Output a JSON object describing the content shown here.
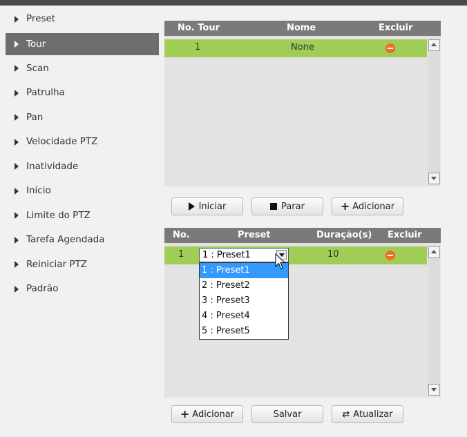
{
  "sidebar": {
    "items": [
      {
        "label": "Preset",
        "active": false
      },
      {
        "label": "Tour",
        "active": true
      },
      {
        "label": "Scan",
        "active": false
      },
      {
        "label": "Patrulha",
        "active": false
      },
      {
        "label": "Pan",
        "active": false
      },
      {
        "label": "Velocidade PTZ",
        "active": false
      },
      {
        "label": "Inatividade",
        "active": false
      },
      {
        "label": "Início",
        "active": false
      },
      {
        "label": "Limite do PTZ",
        "active": false
      },
      {
        "label": "Tarefa Agendada",
        "active": false
      },
      {
        "label": "Reiniciar PTZ",
        "active": false
      },
      {
        "label": "Padrão",
        "active": false
      }
    ]
  },
  "tour_table": {
    "headers": {
      "no": "No. Tour",
      "name": "Nome",
      "delete": "Excluir"
    },
    "rows": [
      {
        "no": "1",
        "name": "None",
        "delete_icon": "minus-circle-icon"
      }
    ]
  },
  "tour_buttons": {
    "start": "Iniciar",
    "stop": "Parar",
    "add": "Adicionar"
  },
  "preset_table": {
    "headers": {
      "no": "No.",
      "preset": "Preset",
      "duration": "Duração(s)",
      "delete": "Excluir"
    },
    "rows": [
      {
        "no": "1",
        "preset": "1 : Preset1",
        "duration": "10",
        "delete_icon": "minus-circle-icon"
      }
    ]
  },
  "preset_dropdown": {
    "selected": "1 : Preset1",
    "options": [
      "1 : Preset1",
      "2 : Preset2",
      "3 : Preset3",
      "4 : Preset4",
      "5 : Preset5"
    ]
  },
  "bottom_buttons": {
    "add": "Adicionar",
    "save": "Salvar",
    "refresh": "Atualizar"
  },
  "colors": {
    "header": "#7a7a7a",
    "row_highlight": "#9fcd55",
    "active_sidebar": "#6e6e6e",
    "delete_icon": "#f26b2a",
    "dropdown_selected": "#3399ff"
  }
}
